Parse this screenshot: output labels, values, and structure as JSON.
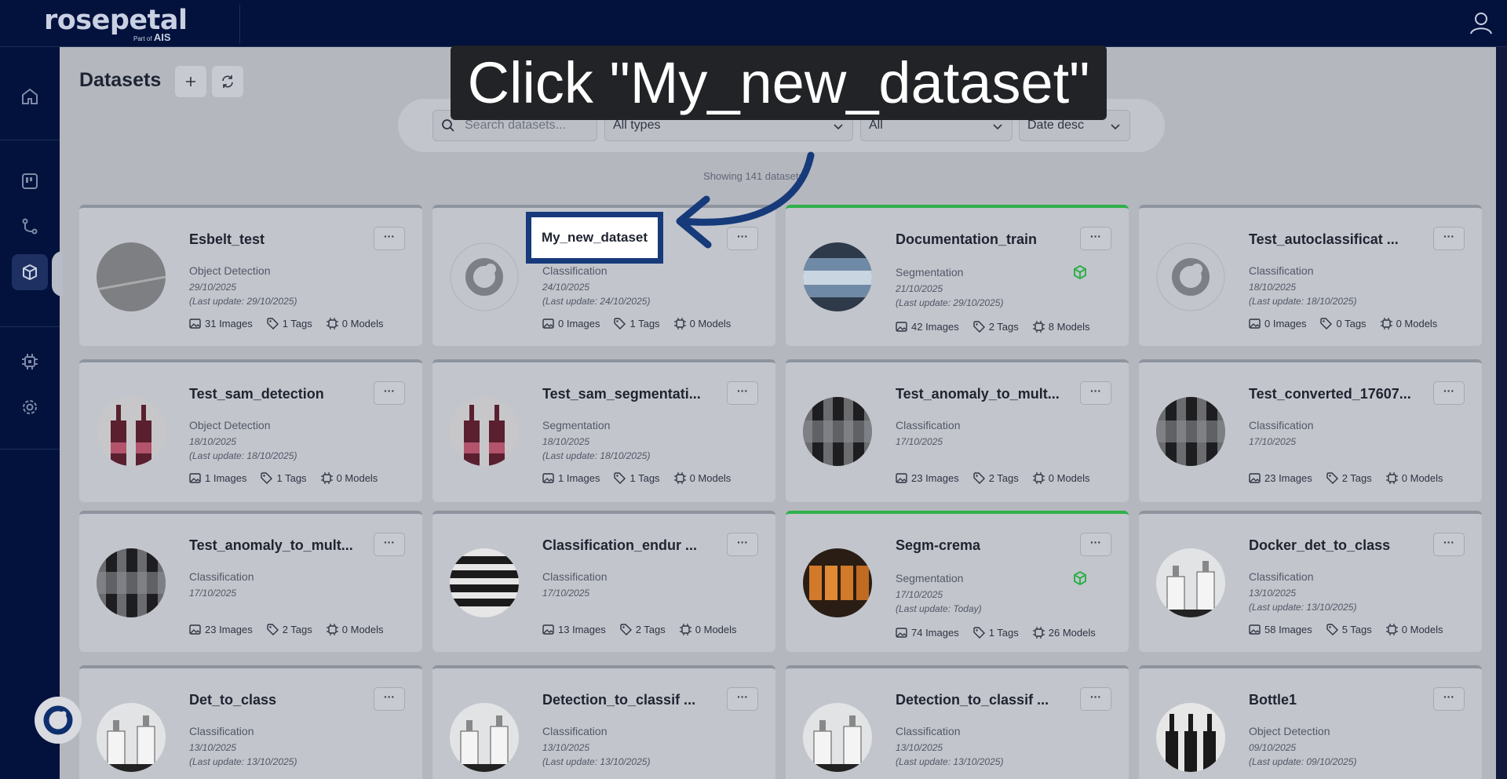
{
  "brand": {
    "name": "rosepetal",
    "sub_prefix": "Part of",
    "sub_brand": "AIS"
  },
  "header": {
    "user_icon": "user-icon"
  },
  "sidebar": {
    "items": [
      "home-icon",
      "board-icon",
      "flow-icon",
      "cube-icon",
      "chip-icon",
      "gear-icon"
    ],
    "active": "cube-icon"
  },
  "page": {
    "title": "Datasets"
  },
  "filters": {
    "search_placeholder": "Search datasets...",
    "type": "All types",
    "status": "All",
    "sort": "Date desc"
  },
  "showing": "Showing 141 datasets",
  "tutorial": {
    "instruction": "Click \"My_new_dataset\"",
    "highlight_label": "My_new_dataset"
  },
  "colors": {
    "header": "#02123d",
    "accent_green": "#2fb04a",
    "arrow": "#163a7a"
  },
  "datasets": [
    {
      "name": "Esbelt_test",
      "type": "Object Detection",
      "date": "29/10/2025",
      "updated": "(Last update: 29/10/2025)",
      "images": "31 Images",
      "tags": "1 Tags",
      "models": "0 Models"
    },
    {
      "name": "My_new_dataset",
      "type": "Classification",
      "date": "24/10/2025",
      "updated": "(Last update: 24/10/2025)",
      "images": "0 Images",
      "tags": "1 Tags",
      "models": "0 Models"
    },
    {
      "name": "Documentation_train",
      "type": "Segmentation",
      "date": "21/10/2025",
      "updated": "(Last update: 29/10/2025)",
      "images": "42 Images",
      "tags": "2 Tags",
      "models": "8 Models"
    },
    {
      "name": "Test_autoclassificat ...",
      "type": "Classification",
      "date": "18/10/2025",
      "updated": "(Last update: 18/10/2025)",
      "images": "0 Images",
      "tags": "0 Tags",
      "models": "0 Models"
    },
    {
      "name": "Test_sam_detection",
      "type": "Object Detection",
      "date": "18/10/2025",
      "updated": "(Last update: 18/10/2025)",
      "images": "1 Images",
      "tags": "1 Tags",
      "models": "0 Models"
    },
    {
      "name": "Test_sam_segmentati...",
      "type": "Segmentation",
      "date": "18/10/2025",
      "updated": "(Last update: 18/10/2025)",
      "images": "1 Images",
      "tags": "1 Tags",
      "models": "0 Models"
    },
    {
      "name": "Test_anomaly_to_mult...",
      "type": "Classification",
      "date": "17/10/2025",
      "updated": "",
      "images": "23 Images",
      "tags": "2 Tags",
      "models": "0 Models"
    },
    {
      "name": "Test_converted_17607...",
      "type": "Classification",
      "date": "17/10/2025",
      "updated": "",
      "images": "23 Images",
      "tags": "2 Tags",
      "models": "0 Models"
    },
    {
      "name": "Test_anomaly_to_mult...",
      "type": "Classification",
      "date": "17/10/2025",
      "updated": "",
      "images": "23 Images",
      "tags": "2 Tags",
      "models": "0 Models"
    },
    {
      "name": "Classification_endur ...",
      "type": "Classification",
      "date": "17/10/2025",
      "updated": "",
      "images": "13 Images",
      "tags": "2 Tags",
      "models": "0 Models"
    },
    {
      "name": "Segm-crema",
      "type": "Segmentation",
      "date": "17/10/2025",
      "updated": "(Last update: Today)",
      "images": "74 Images",
      "tags": "1 Tags",
      "models": "26 Models"
    },
    {
      "name": "Docker_det_to_class",
      "type": "Classification",
      "date": "13/10/2025",
      "updated": "(Last update: 13/10/2025)",
      "images": "58 Images",
      "tags": "5 Tags",
      "models": "0 Models"
    },
    {
      "name": "Det_to_class",
      "type": "Classification",
      "date": "13/10/2025",
      "updated": "(Last update: 13/10/2025)",
      "images": "",
      "tags": "",
      "models": ""
    },
    {
      "name": "Detection_to_classif ...",
      "type": "Classification",
      "date": "13/10/2025",
      "updated": "(Last update: 13/10/2025)",
      "images": "",
      "tags": "",
      "models": ""
    },
    {
      "name": "Detection_to_classif ...",
      "type": "Classification",
      "date": "13/10/2025",
      "updated": "(Last update: 13/10/2025)",
      "images": "",
      "tags": "",
      "models": ""
    },
    {
      "name": "Bottle1",
      "type": "Object Detection",
      "date": "09/10/2025",
      "updated": "(Last update: 09/10/2025)",
      "images": "",
      "tags": "",
      "models": ""
    }
  ],
  "more_label": "···"
}
